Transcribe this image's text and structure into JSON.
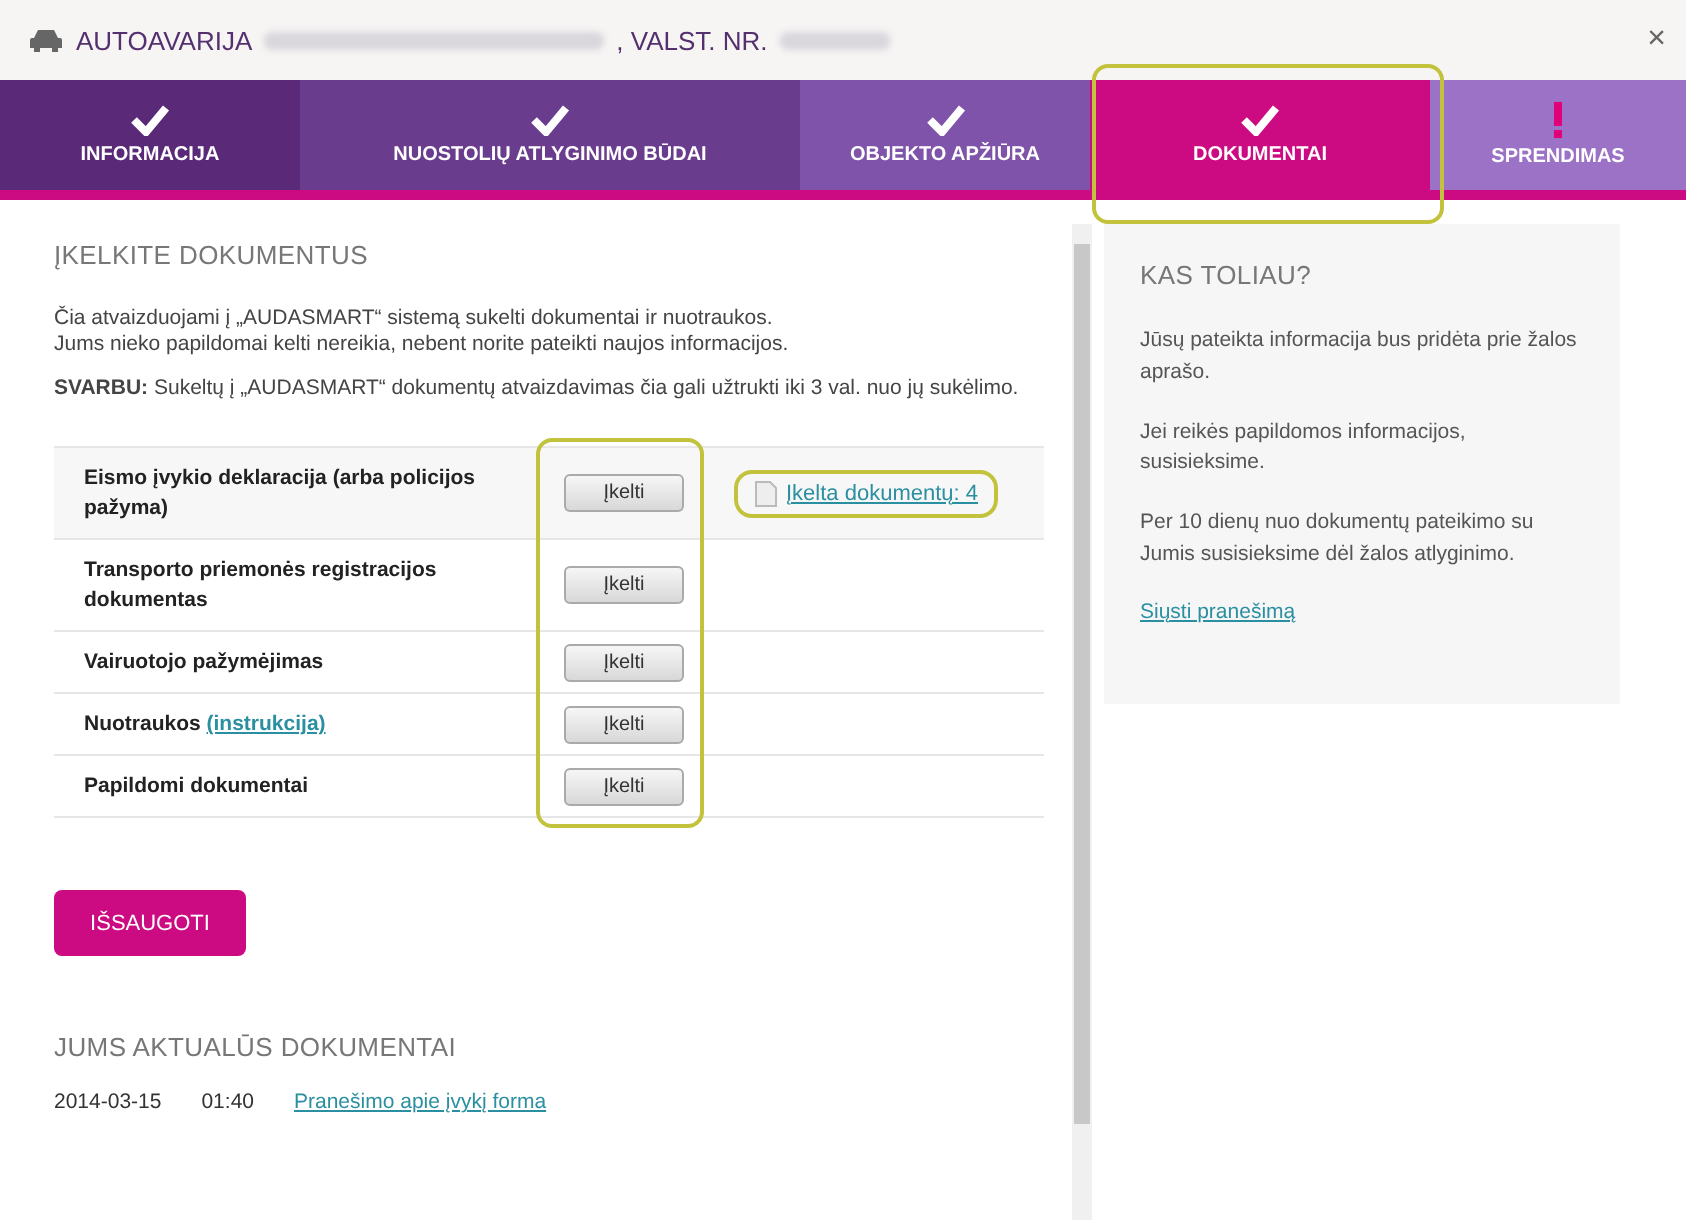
{
  "window": {
    "title_prefix": "AUTOAVARIJA",
    "title_middle": ", VALST. NR.",
    "close": "×"
  },
  "tabs": [
    {
      "label": "INFORMACIJA",
      "kind": "done",
      "selected": false,
      "highlighted": false
    },
    {
      "label": "NUOSTOLIŲ ATLYGINIMO BŪDAI",
      "kind": "done",
      "selected": false,
      "highlighted": false
    },
    {
      "label": "OBJEKTO APŽIŪRA",
      "kind": "done",
      "selected": false,
      "highlighted": false
    },
    {
      "label": "DOKUMENTAI",
      "kind": "done",
      "selected": true,
      "highlighted": true
    },
    {
      "label": "SPRENDIMAS",
      "kind": "attention",
      "selected": false,
      "highlighted": false
    }
  ],
  "upload": {
    "heading": "ĮKELKITE DOKUMENTUS",
    "intro": "Čia atvaizduojami į „AUDASMART“ sistemą sukelti dokumentai ir nuotraukos.\nJums nieko papildomai kelti nereikia, nebent norite pateikti naujos informacijos.",
    "note": "**SVARBU:** Sukeltų į „AUDASMART“ dokumentų atvaizdavimas čia gali užtrukti iki 3 val. nuo jų sukėlimo.",
    "buttons_highlighted": true,
    "rows": [
      {
        "label": "Eismo įvykio deklaracija (arba policijos pažyma)",
        "button": "Įkelti",
        "uploaded": {
          "text": "Įkelta dokumentų: 4",
          "highlighted": true
        }
      },
      {
        "label": "Transporto priemonės registracijos dokumentas",
        "button": "Įkelti"
      },
      {
        "label": "Vairuotojo pažymėjimas",
        "button": "Įkelti"
      },
      {
        "label": "Nuotraukos",
        "link": "(instrukcija)",
        "button": "Įkelti"
      },
      {
        "label": "Papildomi dokumentai",
        "button": "Įkelti"
      }
    ],
    "save": "IŠSAUGOTI"
  },
  "relevant": {
    "heading": "JUMS AKTUALŪS DOKUMENTAI",
    "items": [
      {
        "date": "2014-03-15",
        "time": "01:40",
        "link": "Pranešimo apie įvykį forma"
      }
    ]
  },
  "sidebar": {
    "heading": "KAS TOLIAU?",
    "paragraphs": [
      "Jūsų pateikta informacija bus pridėta prie žalos aprašo.",
      "Jei reikės papildomos informacijos, susisieksime.",
      "Per 10 dienų nuo dokumentų pateikimo su Jumis susisieksime dėl žalos atlyginimo."
    ],
    "link": "Siųsti pranešimą"
  }
}
